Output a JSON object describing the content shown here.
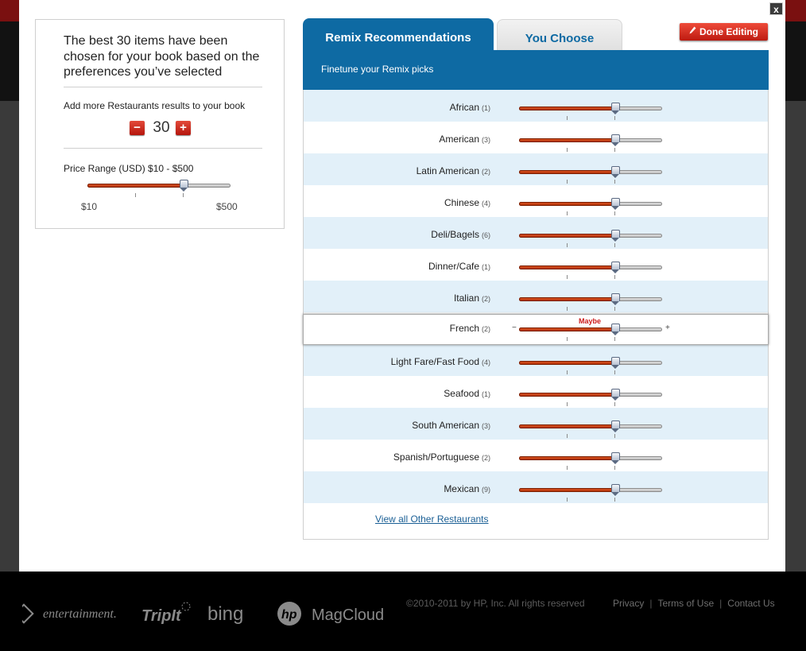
{
  "modal": {
    "close_label": "x",
    "left_panel": {
      "title": "The best 30 items have been chosen for your book based on the preferences you’ve selected",
      "add_label": "Add more Restaurants results to your book",
      "count_value": "30",
      "minus_label": "−",
      "plus_label": "+",
      "price_label": "Price Range (USD) $10 - $500",
      "price_min": "$10",
      "price_max": "$500",
      "price_slider_fraction": 0.67
    },
    "tabs": [
      {
        "label": "Remix Recommendations",
        "active": true
      },
      {
        "label": "You Choose",
        "active": false
      }
    ],
    "done_label": "Done Editing",
    "subtitle": "Finetune your Remix picks",
    "categories": [
      {
        "name": "African",
        "count": "(1)",
        "level": 0.67
      },
      {
        "name": "American",
        "count": "(3)",
        "level": 0.67
      },
      {
        "name": "Latin American",
        "count": "(2)",
        "level": 0.67
      },
      {
        "name": "Chinese",
        "count": "(4)",
        "level": 0.67
      },
      {
        "name": "Deli/Bagels",
        "count": "(6)",
        "level": 0.67
      },
      {
        "name": "Dinner/Cafe",
        "count": "(1)",
        "level": 0.67
      },
      {
        "name": "Italian",
        "count": "(2)",
        "level": 0.67
      },
      {
        "name": "French",
        "count": "(2)",
        "level": 0.67,
        "hover_label": "Maybe"
      },
      {
        "name": "Light Fare/Fast Food",
        "count": "(4)",
        "level": 0.67
      },
      {
        "name": "Seafood",
        "count": "(1)",
        "level": 0.67
      },
      {
        "name": "South American",
        "count": "(3)",
        "level": 0.67
      },
      {
        "name": "Spanish/Portuguese",
        "count": "(2)",
        "level": 0.67
      },
      {
        "name": "Mexican",
        "count": "(9)",
        "level": 0.67
      }
    ],
    "slider_minus": "−",
    "slider_plus": "+",
    "view_all_label": "View all Other Restaurants"
  },
  "footer": {
    "logos": [
      "entertainment",
      "TripIt",
      "bing",
      "hp",
      "MagCloud"
    ],
    "copyright": "©2010-2011 by HP, Inc. All rights reserved",
    "links": [
      "Privacy",
      "Terms of Use",
      "Contact Us"
    ]
  },
  "colors": {
    "accent_blue": "#0e6aa3",
    "row_alt": "#e2f0f9",
    "slider_fill": "#c43a0a",
    "button_red": "#d42a1c"
  }
}
